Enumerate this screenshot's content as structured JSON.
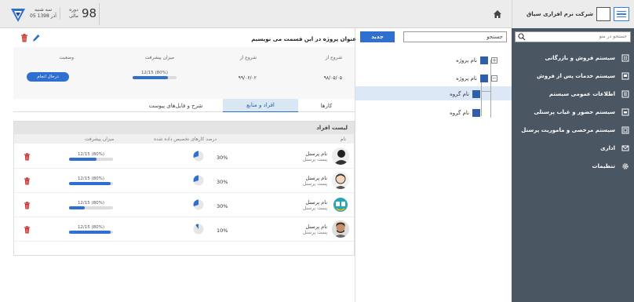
{
  "header": {
    "company_name": "شرکت نرم افزاری سپاق",
    "day_name": "سه شنبه",
    "date": "05 آذر 1398",
    "period_label_1": "دوره",
    "period_label_2": "مالی",
    "period_value": "98"
  },
  "sidebar": {
    "search_placeholder": "جستجو در منو",
    "items": [
      {
        "label": "سیستم فروش و بازرگانی",
        "icon": "building-icon"
      },
      {
        "label": "سیستم خدمات پس از فروش",
        "icon": "service-icon"
      },
      {
        "label": "اطلاعات عمومی سیستم",
        "icon": "info-icon"
      },
      {
        "label": "سیستم حضور و غیاب پرسنلی",
        "icon": "attendance-icon"
      },
      {
        "label": "سیستم مرخصی و ماموریت پرسنل",
        "icon": "leave-icon"
      },
      {
        "label": "اداری",
        "icon": "mail-icon"
      },
      {
        "label": "تنظیمات",
        "icon": "gear-icon"
      }
    ]
  },
  "middle": {
    "search_value": "جستجو",
    "new_button": "جدید",
    "tree": [
      {
        "label": "نام پروژه"
      },
      {
        "label": "نام پروژه"
      },
      {
        "label": "نام گروه"
      },
      {
        "label": "نام گروه"
      }
    ]
  },
  "project": {
    "title": "عنوان پروژه در این قسمت می نویسیم",
    "headers": {
      "start_from": "شروع از",
      "start": "شروع از",
      "progress": "میزان پیشرفت",
      "status": "وضعیت"
    },
    "values": {
      "start_from": "۹۸/۰۵/۰۵",
      "start": "۹۹/۰۶/۰۲",
      "progress_text": "12/15 (80%)",
      "progress": 0.8,
      "status": "درحال انجام"
    }
  },
  "tabs": [
    "کارها",
    "افراد و منابع",
    "شرح و فایل‌های پیوست"
  ],
  "people": {
    "title": "لیست افراد",
    "columns": {
      "name": "نام",
      "percent": "درصد کارهای تخصیص داده شده",
      "progress": "میزان پیشرفت"
    },
    "rows": [
      {
        "name": "نام پرسنل",
        "post": "پست پرسنل",
        "percent": "30%",
        "share": 0.3,
        "progress_text": "12/15 (80%)",
        "progress": 0.63
      },
      {
        "name": "نام پرسنل",
        "post": "پست پرسنل",
        "percent": "30%",
        "share": 0.3,
        "progress_text": "12/15 (80%)",
        "progress": 0.95
      },
      {
        "name": "نام پرسنل",
        "post": "پست پرسنل",
        "percent": "30%",
        "share": 0.3,
        "progress_text": "12/15 (80%)",
        "progress": 0.35
      },
      {
        "name": "نام پرسنل",
        "post": "پست پرسنل",
        "percent": "10%",
        "share": 0.1,
        "progress_text": "12/15 (80%)",
        "progress": 0.95
      }
    ]
  },
  "colors": {
    "accent": "#2f6fd0",
    "sidebar_bg": "#4b5663"
  }
}
